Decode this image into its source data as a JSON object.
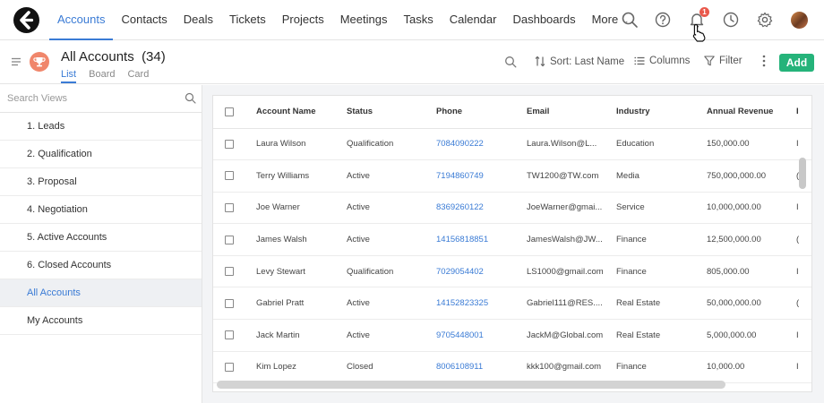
{
  "nav": {
    "items": [
      {
        "label": "Accounts",
        "active": true
      },
      {
        "label": "Contacts",
        "active": false
      },
      {
        "label": "Deals",
        "active": false
      },
      {
        "label": "Tickets",
        "active": false
      },
      {
        "label": "Projects",
        "active": false
      },
      {
        "label": "Meetings",
        "active": false
      },
      {
        "label": "Tasks",
        "active": false
      },
      {
        "label": "Calendar",
        "active": false
      },
      {
        "label": "Dashboards",
        "active": false
      }
    ],
    "more_label": "More",
    "notification_count": "1",
    "accent_color": "#3a7bd5"
  },
  "header": {
    "title": "All Accounts",
    "count": "(34)",
    "view_tabs": [
      "List",
      "Board",
      "Card"
    ],
    "sort_label": "Sort: Last Name",
    "columns_label": "Columns",
    "filter_label": "Filter",
    "add_label": "Add",
    "add_color": "#25b37a"
  },
  "sidebar": {
    "search_placeholder": "Search Views",
    "items": [
      {
        "label": "1. Leads",
        "active": false
      },
      {
        "label": "2. Qualification",
        "active": false
      },
      {
        "label": "3. Proposal",
        "active": false
      },
      {
        "label": "4. Negotiation",
        "active": false
      },
      {
        "label": "5. Active Accounts",
        "active": false
      },
      {
        "label": "6. Closed Accounts",
        "active": false
      },
      {
        "label": "All Accounts",
        "active": true
      },
      {
        "label": "My Accounts",
        "active": false
      }
    ]
  },
  "table": {
    "columns": [
      "Account Name",
      "Status",
      "Phone",
      "Email",
      "Industry",
      "Annual Revenue",
      "I"
    ],
    "rows": [
      {
        "name": "Laura Wilson",
        "status": "Qualification",
        "phone": "7084090222",
        "email": "Laura.Wilson@L...",
        "industry": "Education",
        "revenue": "150,000.00",
        "extra": "I"
      },
      {
        "name": "Terry Williams",
        "status": "Active",
        "phone": "7194860749",
        "email": "TW1200@TW.com",
        "industry": "Media",
        "revenue": "750,000,000.00",
        "extra": "("
      },
      {
        "name": "Joe Warner",
        "status": "Active",
        "phone": "8369260122",
        "email": "JoeWarner@gmai...",
        "industry": "Service",
        "revenue": "10,000,000.00",
        "extra": "I"
      },
      {
        "name": "James Walsh",
        "status": "Active",
        "phone": "14156818851",
        "email": "JamesWalsh@JW...",
        "industry": "Finance",
        "revenue": "12,500,000.00",
        "extra": "("
      },
      {
        "name": "Levy Stewart",
        "status": "Qualification",
        "phone": "7029054402",
        "email": "LS1000@gmail.com",
        "industry": "Finance",
        "revenue": "805,000.00",
        "extra": "I"
      },
      {
        "name": "Gabriel Pratt",
        "status": "Active",
        "phone": "14152823325",
        "email": "Gabriel111@RES....",
        "industry": "Real Estate",
        "revenue": "50,000,000.00",
        "extra": "("
      },
      {
        "name": "Jack Martin",
        "status": "Active",
        "phone": "9705448001",
        "email": "JackM@Global.com",
        "industry": "Real Estate",
        "revenue": "5,000,000.00",
        "extra": "I"
      },
      {
        "name": "Kim Lopez",
        "status": "Closed",
        "phone": "8006108911",
        "email": "kkk100@gmail.com",
        "industry": "Finance",
        "revenue": "10,000.00",
        "extra": "I"
      }
    ]
  }
}
